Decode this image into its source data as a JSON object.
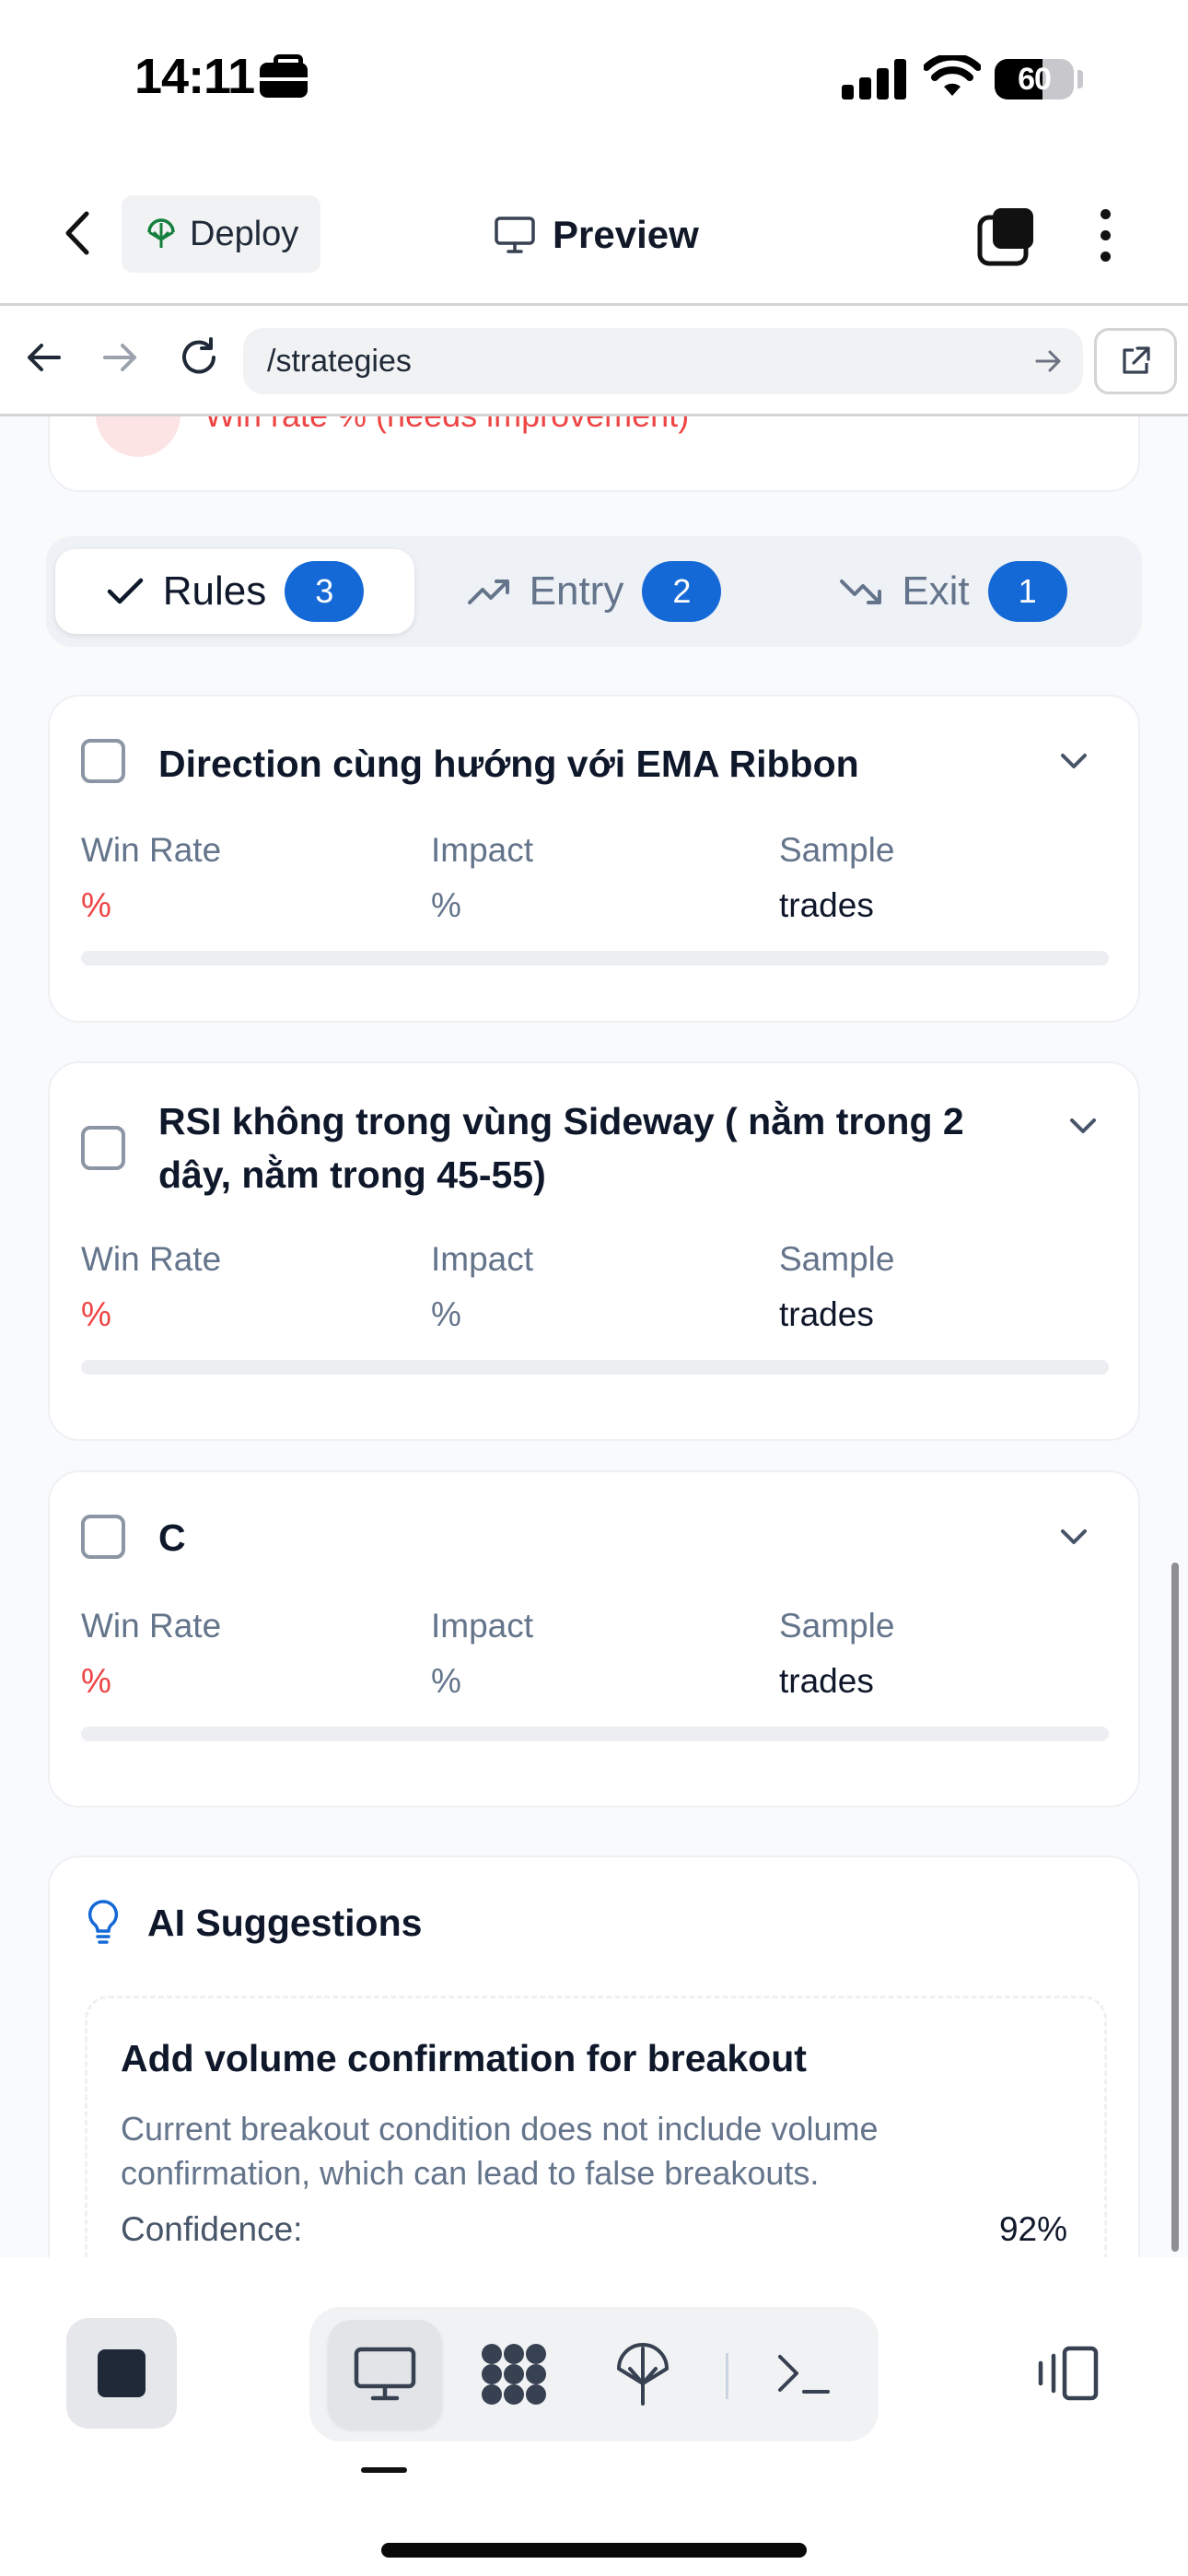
{
  "status_bar": {
    "time": "14:11",
    "battery_percent": "60",
    "battery_level": 0.6
  },
  "header": {
    "deploy_label": "Deploy",
    "preview_label": "Preview"
  },
  "browser": {
    "url": "/strategies"
  },
  "previous_card": {
    "text": "Win rate % (needs improvement)"
  },
  "tabs": [
    {
      "label": "Rules",
      "count": "3",
      "active": true
    },
    {
      "label": "Entry",
      "count": "2",
      "active": false
    },
    {
      "label": "Exit",
      "count": "1",
      "active": false
    }
  ],
  "rules": [
    {
      "title": "Direction cùng hướng với EMA Ribbon",
      "win_rate_label": "Win Rate",
      "win_rate_value": "%",
      "impact_label": "Impact",
      "impact_value": "%",
      "sample_label": "Sample",
      "sample_value": "trades",
      "progress": 0
    },
    {
      "title": "RSI không trong vùng Sideway ( nằm trong 2 dây, nằm trong 45-55)",
      "win_rate_label": "Win Rate",
      "win_rate_value": "%",
      "impact_label": "Impact",
      "impact_value": "%",
      "sample_label": "Sample",
      "sample_value": "trades",
      "progress": 0
    },
    {
      "title": "C",
      "win_rate_label": "Win Rate",
      "win_rate_value": "%",
      "impact_label": "Impact",
      "impact_value": "%",
      "sample_label": "Sample",
      "sample_value": "trades",
      "progress": 0
    }
  ],
  "ai": {
    "title": "AI Suggestions",
    "suggestion": {
      "title": "Add volume confirmation for breakout",
      "description": "Current breakout condition does not include volume confirmation, which can lead to false breakouts.",
      "confidence_label": "Confidence:",
      "confidence_value": "92%"
    }
  },
  "colors": {
    "accent": "#1569d6",
    "danger": "#ef4444",
    "muted": "#64748b"
  },
  "icons": {
    "status": [
      "briefcase-icon",
      "signal-icon",
      "wifi-icon",
      "battery-icon"
    ],
    "header": [
      "chevron-left-icon",
      "globe-tree-icon",
      "monitor-icon",
      "tabs-icon",
      "more-vertical-icon"
    ],
    "browser": [
      "arrow-left-icon",
      "arrow-right-icon",
      "reload-icon",
      "arrow-right-small-icon",
      "external-link-icon"
    ],
    "bottom": [
      "stop-icon",
      "monitor-icon",
      "dots-grid-icon",
      "deploy-tree-icon",
      "terminal-icon",
      "side-panel-icon"
    ]
  }
}
